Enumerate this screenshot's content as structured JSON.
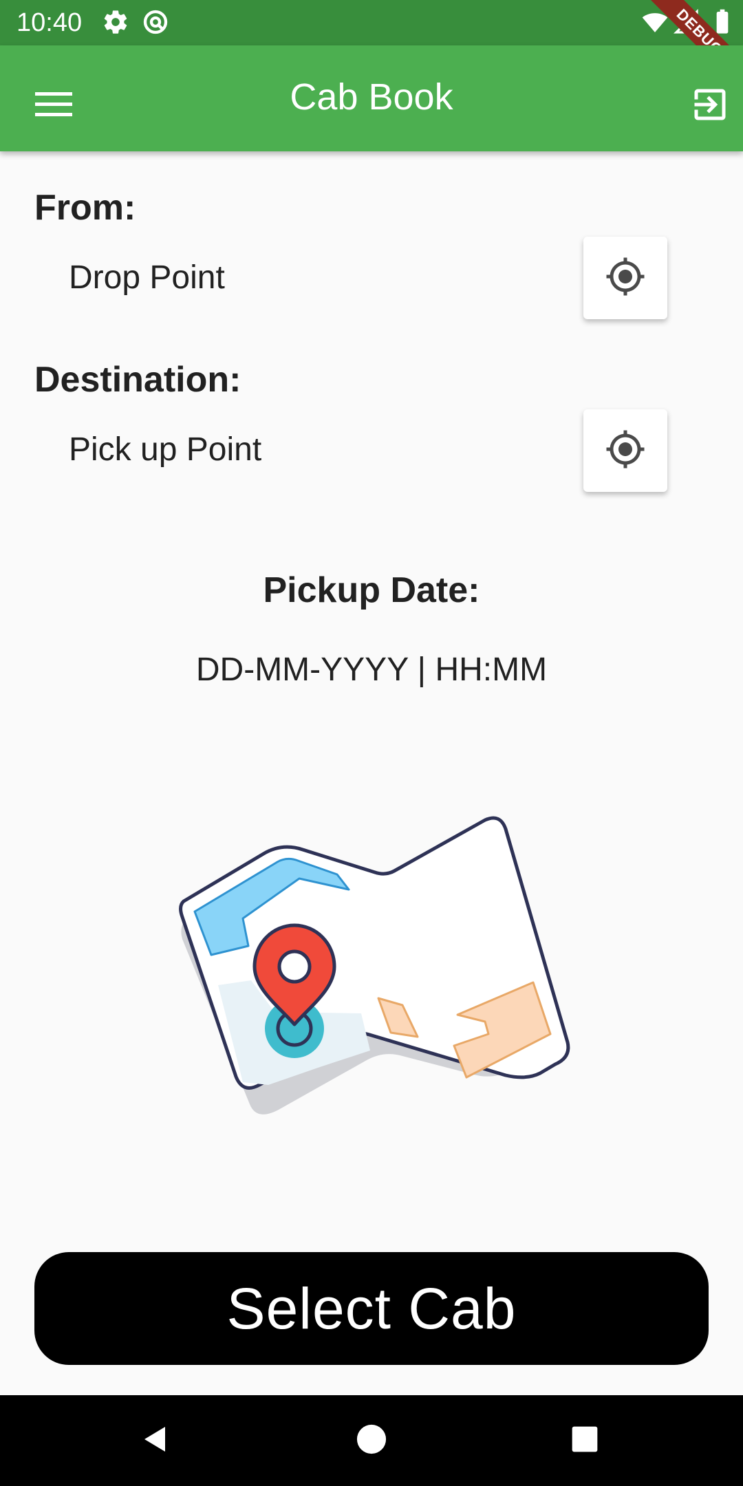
{
  "status_bar": {
    "time": "10:40",
    "icons": [
      "settings-icon",
      "at-sign-icon",
      "wifi-icon",
      "signal-icon",
      "battery-icon"
    ],
    "debug_label": "DEBUG"
  },
  "app_bar": {
    "title": "Cab Book",
    "menu_icon": "menu-icon",
    "logout_icon": "logout-icon",
    "color": "#4caf50"
  },
  "from": {
    "label": "From:",
    "value": "Drop Point",
    "locate_icon": "my-location-icon"
  },
  "destination": {
    "label": "Destination:",
    "value": "Pick up Point",
    "locate_icon": "my-location-icon"
  },
  "pickup": {
    "label": "Pickup Date:",
    "value": "DD-MM-YYYY | HH:MM"
  },
  "illustration": "map-with-pin-icon",
  "select_cab": {
    "label": "Select Cab"
  },
  "nav_bar": {
    "buttons": [
      "back-icon",
      "home-icon",
      "recents-icon"
    ]
  }
}
